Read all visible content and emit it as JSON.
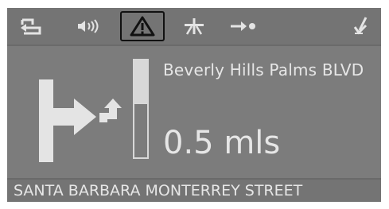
{
  "toolbar": {
    "items": [
      {
        "icon": "back-icon"
      },
      {
        "icon": "volume-icon"
      },
      {
        "icon": "warning-icon",
        "selected": true
      },
      {
        "icon": "highway-icon"
      },
      {
        "icon": "destination-icon"
      },
      {
        "icon": "pen-icon"
      }
    ]
  },
  "guidance": {
    "current_street": "Beverly Hills Palms BLVD",
    "distance": "0.5 mls",
    "progress_fraction": 0.45,
    "maneuver_icon": "turn-right-icon"
  },
  "next_street": "SANTA BARBARA MONTERREY STREET",
  "colors": {
    "background": "#7c7c7c",
    "text": "#e6e6e6",
    "selected_border": "#111111"
  }
}
